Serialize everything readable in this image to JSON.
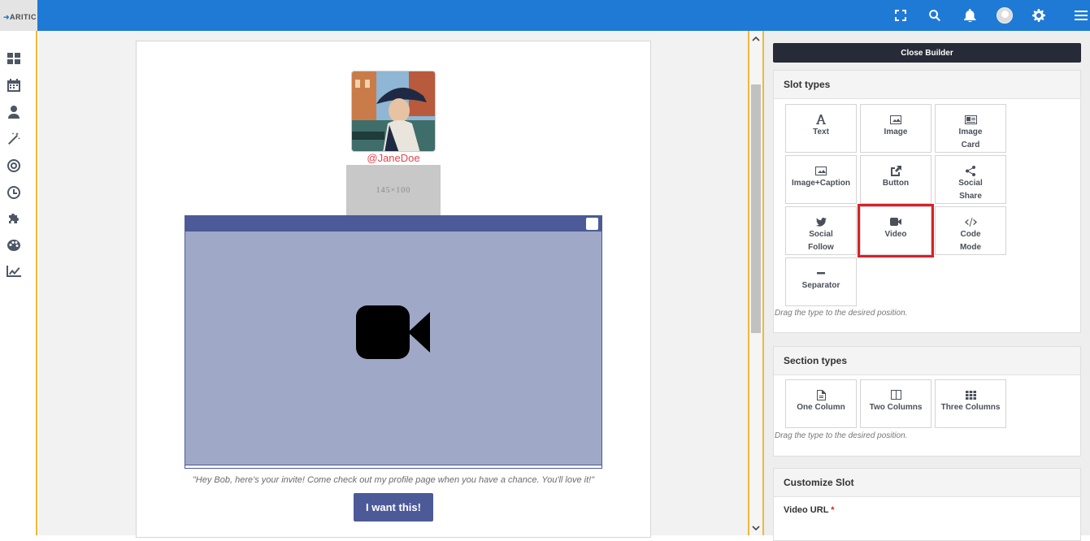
{
  "header": {
    "logo_text": "ARITIC",
    "icons": [
      "fullscreen-icon",
      "search-icon",
      "bell-icon",
      "avatar",
      "gear-icon",
      "menu-icon"
    ]
  },
  "sidebar": {
    "icons": [
      "dashboard-icon",
      "calendar-icon",
      "user-icon",
      "wand-icon",
      "target-icon",
      "clock-icon",
      "puzzle-icon",
      "palette-icon",
      "chart-icon"
    ]
  },
  "email": {
    "handle": "@JaneDoe",
    "placeholder_label": "145×100",
    "quote": "\"Hey Bob, here's your invite! Come check out my profile page when you have a chance. You'll love it!\"",
    "cta_label": "I want this!"
  },
  "panel": {
    "close_label": "Close Builder",
    "slot_types": {
      "title": "Slot types",
      "items": [
        {
          "line1": "Text",
          "line2": ""
        },
        {
          "line1": "Image",
          "line2": ""
        },
        {
          "line1": "Image",
          "line2": "Card"
        },
        {
          "line1": "Image+Caption",
          "line2": ""
        },
        {
          "line1": "Button",
          "line2": ""
        },
        {
          "line1": "Social",
          "line2": "Share"
        },
        {
          "line1": "Social",
          "line2": "Follow"
        },
        {
          "line1": "Video",
          "line2": ""
        },
        {
          "line1": "Code",
          "line2": "Mode"
        },
        {
          "line1": "Separator",
          "line2": ""
        }
      ],
      "hint": "Drag the type to the desired position."
    },
    "section_types": {
      "title": "Section types",
      "items": [
        "One Column",
        "Two Columns",
        "Three Columns"
      ],
      "hint": "Drag the type to the desired position."
    },
    "customize": {
      "title": "Customize Slot",
      "field_label": "Video URL",
      "required_mark": "*"
    }
  },
  "colors": {
    "topbar": "#1f7ad6",
    "accent_border": "#f0b83a",
    "video_bg": "#9fa8c6",
    "video_header": "#4d5a98",
    "highlight": "#dd1f26"
  }
}
